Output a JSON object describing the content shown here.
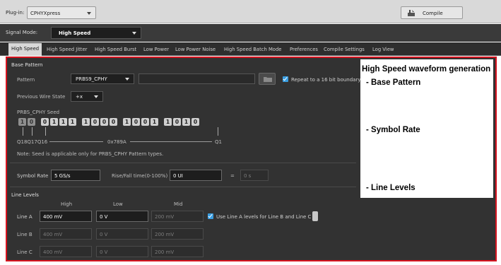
{
  "toolbar": {
    "plugin_label": "Plug-in:",
    "plugin_value": "CPHYXpress",
    "compile_label": "Compile"
  },
  "signal": {
    "label": "Signal Mode:",
    "value": "High Speed"
  },
  "tabs": [
    {
      "label": "High Speed"
    },
    {
      "label": "High Speed Jitter"
    },
    {
      "label": "High Speed Burst"
    },
    {
      "label": "Low Power"
    },
    {
      "label": "Low Power Noise"
    },
    {
      "label": "High Speed Batch Mode"
    },
    {
      "label": "Preferences"
    },
    {
      "label": "Compile Settings"
    },
    {
      "label": "Log View"
    }
  ],
  "base_pattern": {
    "title": "Base Pattern",
    "pattern_label": "Pattern",
    "pattern_value": "PRBS9_CPHY",
    "repeat_label": "Repeat to a 16 bit boundary",
    "prev_wire_label": "Previous Wire State",
    "prev_wire_value": "+x",
    "seed_label": "PRBS_CPHY Seed",
    "seed_bits": [
      "1",
      "0",
      "0",
      "1",
      "1",
      "1",
      "1",
      "0",
      "0",
      "0",
      "1",
      "0",
      "0",
      "1",
      "1",
      "0",
      "1",
      "0"
    ],
    "q_left": "Q18Q17Q16",
    "hex_value": "0x789A",
    "q_right": "Q1",
    "note": "Note: Seed is applicable only for PRBS_CPHY Pattern types."
  },
  "rate": {
    "symbol_label": "Symbol Rate",
    "symbol_value": "5 GS/s",
    "rise_label": "Rise/Fall time(0-100%)",
    "rise_value": "0 UI",
    "equals": "=",
    "result_value": "0 s"
  },
  "line_levels": {
    "title": "Line Levels",
    "col_high": "High",
    "col_low": "Low",
    "col_mid": "Mid",
    "rows": [
      {
        "label": "Line A",
        "high": "400 mV",
        "low": "0 V",
        "mid": "200 mV"
      },
      {
        "label": "Line B",
        "high": "400 mV",
        "low": "0 V",
        "mid": "200 mV"
      },
      {
        "label": "Line C",
        "high": "400 mV",
        "low": "0 V",
        "mid": "200 mV"
      }
    ],
    "use_line_a_label": "Use Line A levels for Line B and Line C"
  },
  "annotation": {
    "title": "High Speed waveform generation",
    "item1": "- Base Pattern",
    "item2": "- Symbol Rate",
    "item3": "- Line Levels"
  },
  "colors": {
    "highlight_border": "#d6131f",
    "checkbox": "#3a9de0"
  }
}
